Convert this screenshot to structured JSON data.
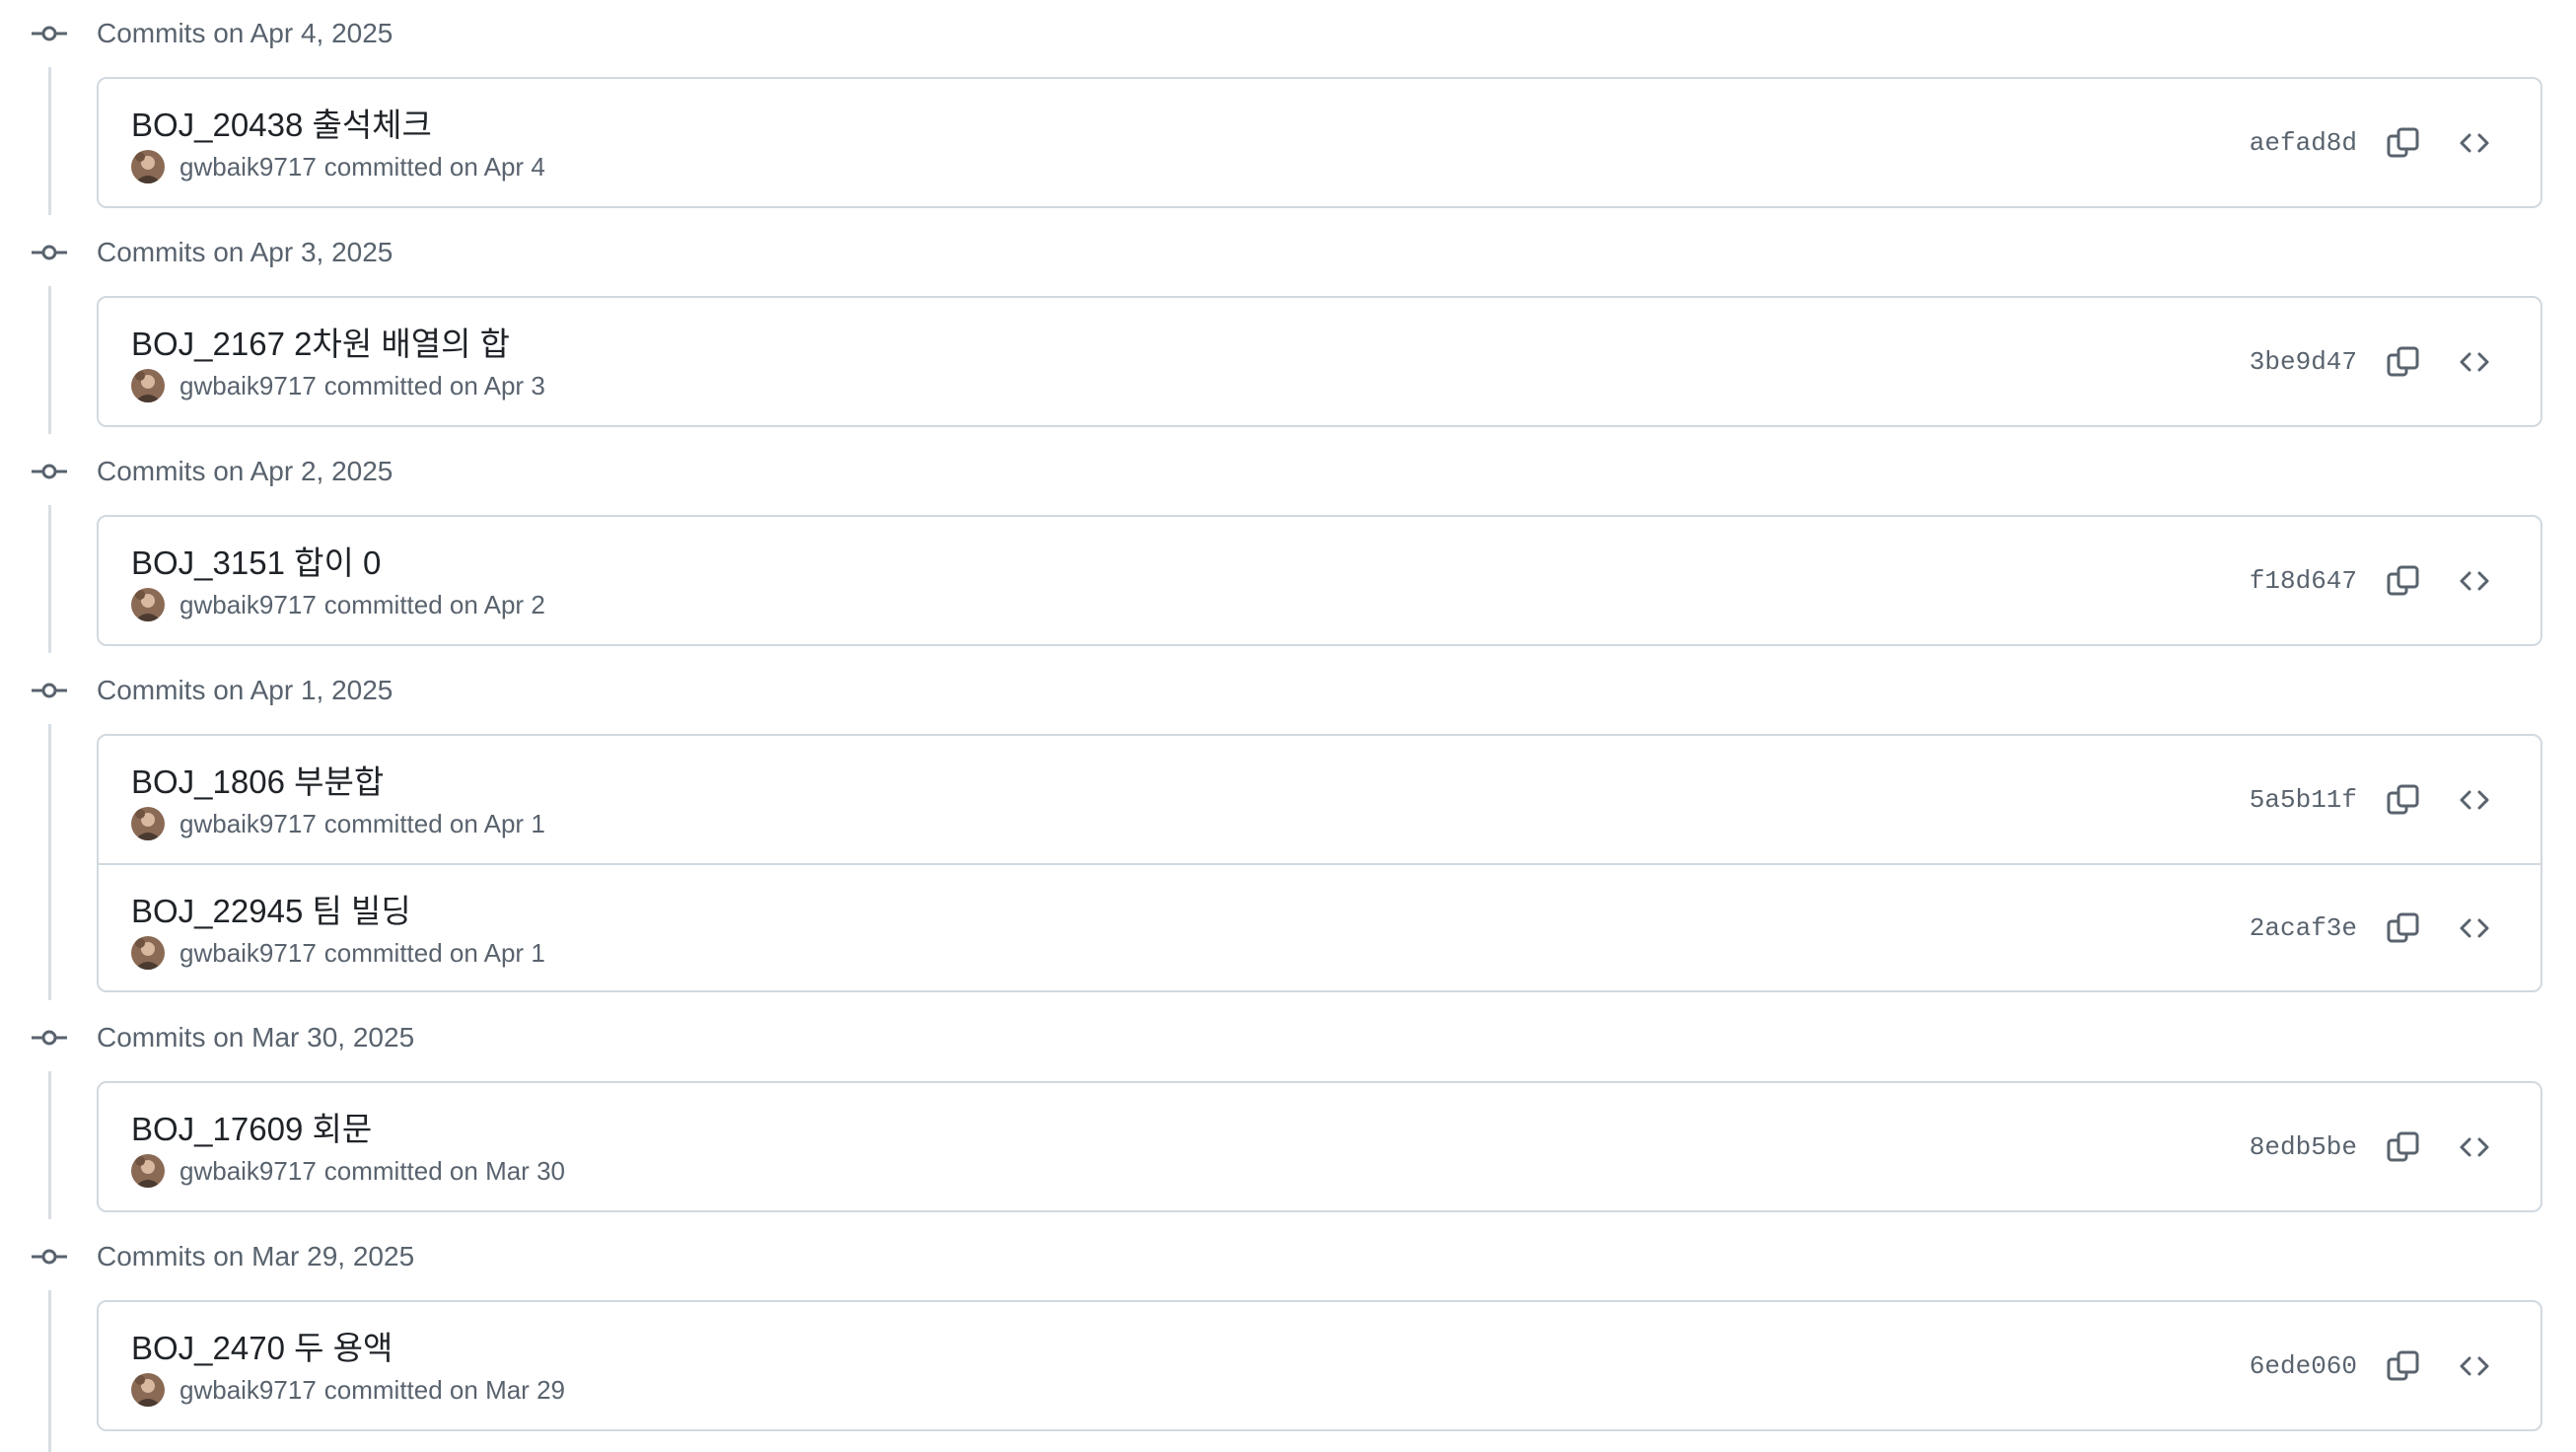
{
  "groups": [
    {
      "date_label": "Commits on Apr 4, 2025",
      "commits": [
        {
          "title": "BOJ_20438 출석체크",
          "author": "gwbaik9717",
          "meta": "committed on Apr 4",
          "sha": "aefad8d"
        }
      ]
    },
    {
      "date_label": "Commits on Apr 3, 2025",
      "commits": [
        {
          "title": "BOJ_2167 2차원 배열의 합",
          "author": "gwbaik9717",
          "meta": "committed on Apr 3",
          "sha": "3be9d47"
        }
      ]
    },
    {
      "date_label": "Commits on Apr 2, 2025",
      "commits": [
        {
          "title": "BOJ_3151 합이 0",
          "author": "gwbaik9717",
          "meta": "committed on Apr 2",
          "sha": "f18d647"
        }
      ]
    },
    {
      "date_label": "Commits on Apr 1, 2025",
      "commits": [
        {
          "title": "BOJ_1806 부분합",
          "author": "gwbaik9717",
          "meta": "committed on Apr 1",
          "sha": "5a5b11f"
        },
        {
          "title": "BOJ_22945 팀 빌딩",
          "author": "gwbaik9717",
          "meta": "committed on Apr 1",
          "sha": "2acaf3e"
        }
      ]
    },
    {
      "date_label": "Commits on Mar 30, 2025",
      "commits": [
        {
          "title": "BOJ_17609 회문",
          "author": "gwbaik9717",
          "meta": "committed on Mar 30",
          "sha": "8edb5be"
        }
      ]
    },
    {
      "date_label": "Commits on Mar 29, 2025",
      "commits": [
        {
          "title": "BOJ_2470 두 용액",
          "author": "gwbaik9717",
          "meta": "committed on Mar 29",
          "sha": "6ede060"
        }
      ]
    }
  ],
  "colors": {
    "text_primary": "#1f2328",
    "text_muted": "#59636e",
    "border": "#d1d9e0",
    "rail": "#d8dee4"
  },
  "icons": {
    "group_marker": "git-commit-icon",
    "copy": "copy-icon",
    "browse": "code-icon",
    "avatar": "user-avatar"
  }
}
